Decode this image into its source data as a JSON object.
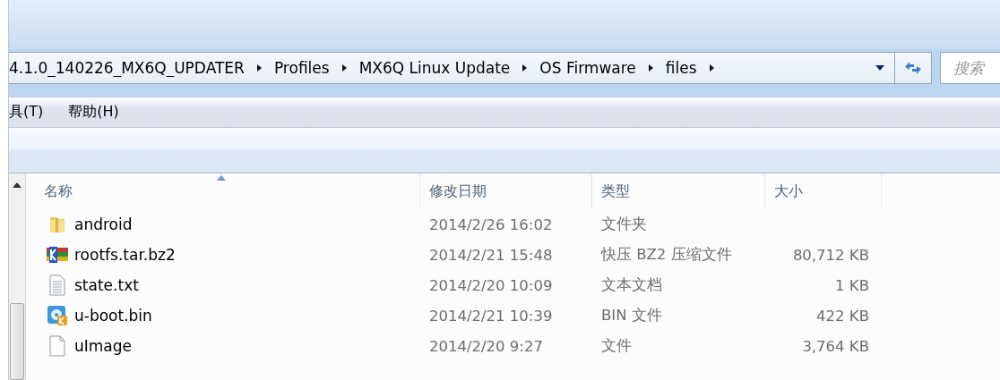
{
  "address_bar": {
    "crumbs": [
      "4.1.0_140226_MX6Q_UPDATER",
      "Profiles",
      "MX6Q Linux Update",
      "OS Firmware",
      "files"
    ]
  },
  "search": {
    "placeholder": "搜索"
  },
  "menu": [
    "具(T)",
    "帮助(H)"
  ],
  "table": {
    "columns": [
      {
        "label": "名称",
        "sorted": true
      },
      {
        "label": "修改日期",
        "sorted": false
      },
      {
        "label": "类型",
        "sorted": false
      },
      {
        "label": "大小",
        "sorted": false
      }
    ],
    "rows": [
      {
        "kind": "folder",
        "name": "android",
        "date": "2014/2/26 16:02",
        "type": "文件夹"
      },
      {
        "kind": "archive",
        "name": "rootfs.tar.bz2",
        "date": "2014/2/21 15:48",
        "type": "快压 BZ2 压缩文件",
        "size": "80,712 KB"
      },
      {
        "kind": "text",
        "name": "state.txt",
        "date": "2014/2/20 10:09",
        "type": "文本文档",
        "size": "1 KB"
      },
      {
        "kind": "bin",
        "name": "u-boot.bin",
        "date": "2014/2/21 10:39",
        "type": "BIN 文件",
        "size": "422 KB"
      },
      {
        "kind": "file",
        "name": "uImage",
        "date": "2014/2/20 9:27",
        "type": "文件",
        "size": "3,764 KB"
      }
    ]
  }
}
